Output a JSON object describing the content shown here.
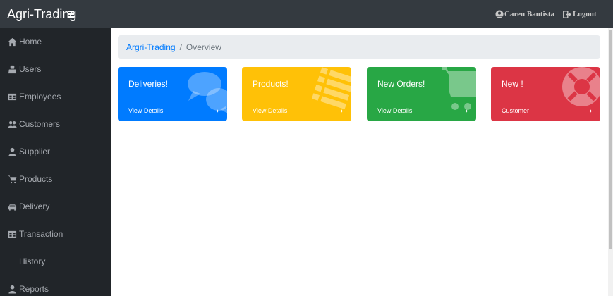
{
  "app": {
    "brand": "Agri-Trading"
  },
  "header": {
    "user_name": "Caren Bautista",
    "logout_label": "Logout"
  },
  "sidebar": {
    "items": [
      {
        "label": "Home",
        "icon": "home-icon"
      },
      {
        "label": "Users",
        "icon": "users-icon"
      },
      {
        "label": "Employees",
        "icon": "table-icon"
      },
      {
        "label": "Customers",
        "icon": "group-icon"
      },
      {
        "label": "Supplier",
        "icon": "user-tie-icon"
      },
      {
        "label": "Products",
        "icon": "cart-icon"
      },
      {
        "label": "Delivery",
        "icon": "car-icon"
      },
      {
        "label": "Transaction",
        "icon": "table-icon"
      },
      {
        "label": "History",
        "icon": ""
      },
      {
        "label": "Reports",
        "icon": "user-tie-icon"
      }
    ]
  },
  "breadcrumb": {
    "root": "Argri-Trading",
    "separator": "/",
    "current": "Overview"
  },
  "cards": [
    {
      "title": "Deliveries!",
      "link": "View Details",
      "chevron": "›",
      "color": "#007bff",
      "icon": "comments-icon"
    },
    {
      "title": "Products!",
      "link": "View Details",
      "chevron": "›",
      "color": "#ffc107",
      "icon": "list-icon"
    },
    {
      "title": "New Orders!",
      "link": "View Details",
      "chevron": "›",
      "color": "#28a745",
      "icon": "shopping-cart-icon"
    },
    {
      "title": "New !",
      "link": "Customer",
      "chevron": "›",
      "color": "#dc3545",
      "icon": "life-ring-icon"
    }
  ]
}
